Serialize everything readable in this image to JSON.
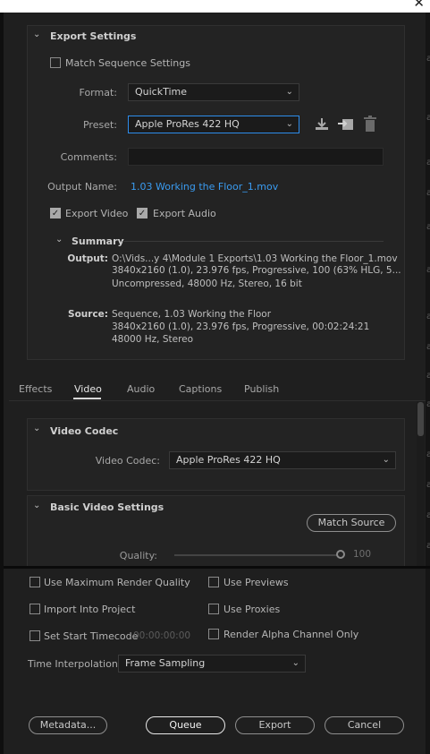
{
  "export_settings": {
    "title": "Export Settings",
    "match_sequence_label": "Match Sequence Settings",
    "format_label": "Format:",
    "format_value": "QuickTime",
    "preset_label": "Preset:",
    "preset_value": "Apple ProRes 422 HQ",
    "comments_label": "Comments:",
    "comments_value": "",
    "output_name_label": "Output Name:",
    "output_name_value": "1.03 Working the Floor_1.mov",
    "export_video_label": "Export Video",
    "export_audio_label": "Export Audio",
    "export_video_checked": true,
    "export_audio_checked": true,
    "icons": [
      "save-preset-icon",
      "import-preset-icon",
      "delete-preset-icon"
    ]
  },
  "summary": {
    "title": "Summary",
    "output_label": "Output:",
    "output_lines": [
      "O:\\Vids...y 4\\Module 1 Exports\\1.03 Working the Floor_1.mov",
      "3840x2160 (1.0), 23.976 fps, Progressive, 100 (63% HLG, 5...",
      "Uncompressed, 48000 Hz, Stereo, 16 bit"
    ],
    "source_label": "Source:",
    "source_lines": [
      "Sequence, 1.03 Working the Floor",
      "3840x2160 (1.0), 23.976 fps, Progressive, 00:02:24:21",
      "48000 Hz, Stereo"
    ]
  },
  "tabs": {
    "items": [
      "Effects",
      "Video",
      "Audio",
      "Captions",
      "Publish"
    ],
    "active": "Video"
  },
  "video_codec": {
    "title": "Video Codec",
    "label": "Video Codec:",
    "value": "Apple ProRes 422 HQ"
  },
  "basic_video": {
    "title": "Basic Video Settings",
    "match_source_label": "Match Source",
    "quality_label": "Quality:",
    "quality_value": "100"
  },
  "options": {
    "max_render_quality": "Use Maximum Render Quality",
    "use_previews": "Use Previews",
    "import_into_project": "Import Into Project",
    "use_proxies": "Use Proxies",
    "set_start_timecode": "Set Start Timecode",
    "start_timecode_value": "00:00:00:00",
    "render_alpha": "Render Alpha Channel Only",
    "time_interpolation_label": "Time Interpolation:",
    "time_interpolation_value": "Frame Sampling"
  },
  "footer": {
    "metadata_label": "Metadata...",
    "queue_label": "Queue",
    "export_label": "Export",
    "cancel_label": "Cancel"
  },
  "colors": {
    "accent": "#2d8ceb",
    "link": "#3a9bf0",
    "background": "#1f1f1f"
  }
}
